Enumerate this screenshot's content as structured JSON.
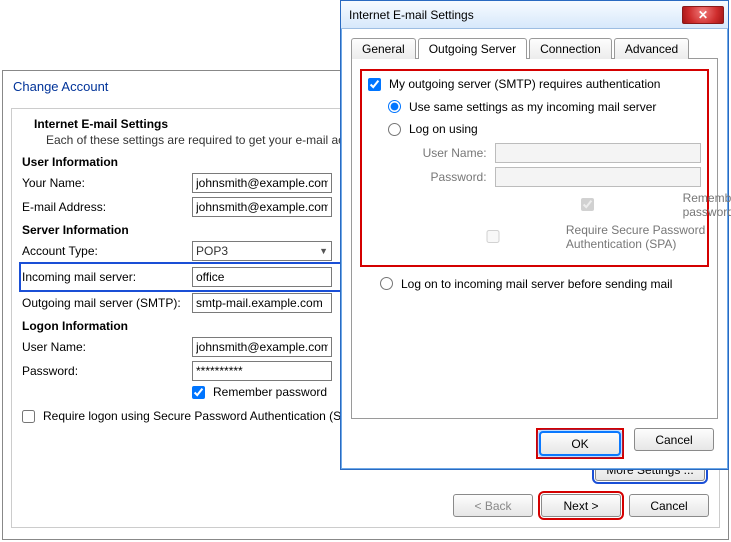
{
  "backWindow": {
    "title": "Change Account",
    "subhead": "Internet E-mail Settings",
    "subdesc": "Each of these settings are required to get your e-mail acco",
    "sections": {
      "user": "User Information",
      "server": "Server Information",
      "logon": "Logon Information"
    },
    "labels": {
      "yourName": "Your Name:",
      "email": "E-mail Address:",
      "accountType": "Account Type:",
      "incoming": "Incoming mail server:",
      "outgoing": "Outgoing mail server (SMTP):",
      "userName": "User Name:",
      "password": "Password:",
      "remember": "Remember password",
      "spa": "Require logon using Secure Password Authentication (SPA)"
    },
    "values": {
      "yourName": "johnsmith@example.com",
      "email": "johnsmith@example.com",
      "accountType": "POP3",
      "incoming": "office",
      "outgoing": "smtp-mail.example.com",
      "userName": "johnsmith@example.com",
      "password": "**********"
    },
    "buttons": {
      "more": "More Settings ...",
      "back": "< Back",
      "next": "Next >",
      "cancel": "Cancel"
    }
  },
  "dialog": {
    "title": "Internet E-mail Settings",
    "tabs": {
      "general": "General",
      "outgoing": "Outgoing Server",
      "connection": "Connection",
      "advanced": "Advanced"
    },
    "options": {
      "requiresAuth": "My outgoing server (SMTP) requires authentication",
      "sameSettings": "Use same settings as my incoming mail server",
      "logOnUsing": "Log on using",
      "userName": "User Name:",
      "password": "Password:",
      "remember": "Remember password",
      "spa": "Require Secure Password Authentication (SPA)",
      "logonIncoming": "Log on to incoming mail server before sending mail"
    },
    "buttons": {
      "ok": "OK",
      "cancel": "Cancel"
    }
  }
}
